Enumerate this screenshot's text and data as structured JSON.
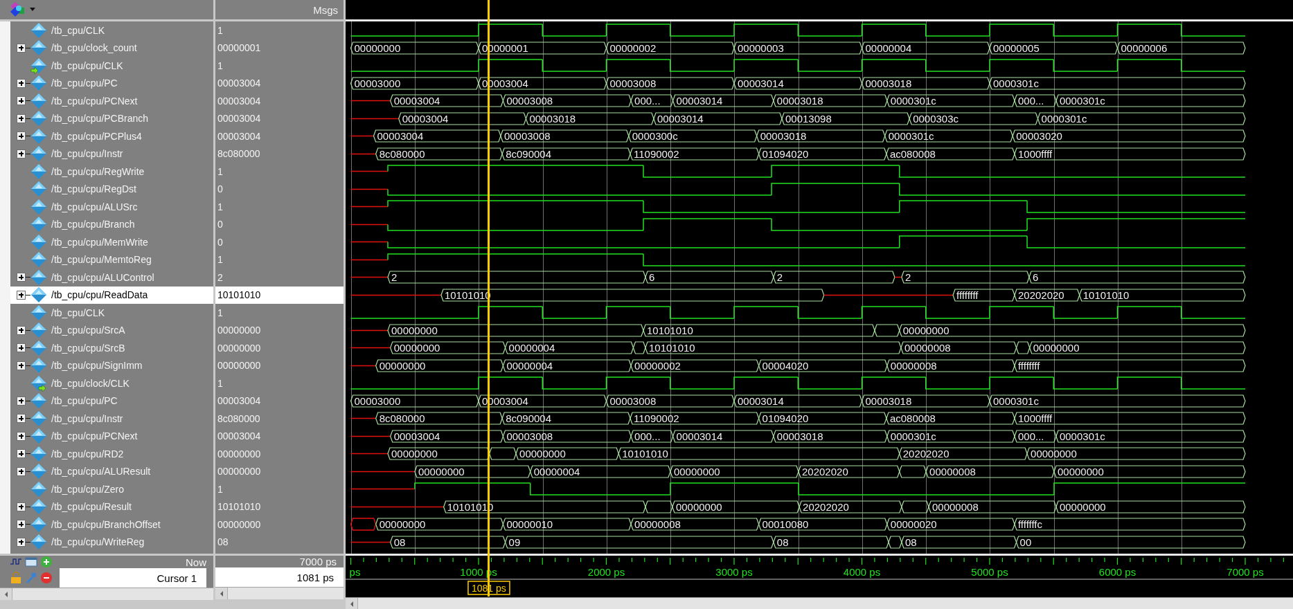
{
  "header": {
    "values_title": "Msgs"
  },
  "signals": [
    {
      "name": "/tb_cpu/CLK",
      "value": "1",
      "kind": "bit",
      "selected": false,
      "wave": [
        {
          "kind": "low"
        },
        {
          "kind": "high"
        },
        {
          "kind": "low"
        },
        {
          "kind": "high"
        },
        {
          "kind": "low"
        },
        {
          "kind": "high"
        },
        {
          "kind": "low"
        },
        {
          "kind": "high"
        },
        {
          "kind": "low"
        },
        {
          "kind": "high"
        },
        {
          "kind": "low"
        },
        {
          "kind": "high"
        },
        {
          "kind": "low"
        }
      ]
    },
    {
      "name": "/tb_cpu/clock_count",
      "value": "00000001",
      "kind": "bus",
      "expanded": false,
      "selected": false,
      "wave": [
        {
          "kind": "value",
          "text": "00000000"
        },
        {
          "kind": "value",
          "text": "00000001"
        },
        {
          "kind": "value",
          "text": "00000002"
        },
        {
          "kind": "value",
          "text": "00000003"
        },
        {
          "kind": "value",
          "text": "00000004"
        },
        {
          "kind": "value",
          "text": "00000005"
        },
        {
          "kind": "value",
          "text": "00000006"
        }
      ]
    },
    {
      "name": "/tb_cpu/cpu/CLK",
      "value": "1",
      "kind": "bit",
      "in_arrow": true,
      "selected": false,
      "wave": [
        {
          "kind": "low"
        },
        {
          "kind": "high"
        },
        {
          "kind": "low"
        },
        {
          "kind": "high"
        },
        {
          "kind": "low"
        },
        {
          "kind": "high"
        },
        {
          "kind": "low"
        },
        {
          "kind": "high"
        },
        {
          "kind": "low"
        },
        {
          "kind": "high"
        },
        {
          "kind": "low"
        },
        {
          "kind": "high"
        },
        {
          "kind": "low"
        }
      ]
    },
    {
      "name": "/tb_cpu/cpu/PC",
      "value": "00003004",
      "kind": "bus",
      "expanded": false,
      "selected": false,
      "wave": [
        {
          "kind": "value",
          "text": "00003000"
        },
        {
          "kind": "value",
          "text": "00003004"
        },
        {
          "kind": "value",
          "text": "00003008"
        },
        {
          "kind": "value",
          "text": "00003014"
        },
        {
          "kind": "value",
          "text": "00003018"
        },
        {
          "kind": "value",
          "text": "0000301c"
        }
      ]
    },
    {
      "name": "/tb_cpu/cpu/PCNext",
      "value": "00003004",
      "kind": "bus",
      "expanded": false,
      "selected": false,
      "wave": [
        {
          "kind": "unknown"
        },
        {
          "kind": "value",
          "text": "00003004"
        },
        {
          "kind": "value",
          "text": "00003008"
        },
        {
          "kind": "value",
          "text": "000..."
        },
        {
          "kind": "value",
          "text": "00003014"
        },
        {
          "kind": "value",
          "text": "00003018"
        },
        {
          "kind": "value",
          "text": "0000301c"
        },
        {
          "kind": "value",
          "text": "000..."
        },
        {
          "kind": "value",
          "text": "0000301c"
        }
      ]
    },
    {
      "name": "/tb_cpu/cpu/PCBranch",
      "value": "00003004",
      "kind": "bus",
      "expanded": false,
      "selected": false,
      "wave": [
        {
          "kind": "unknown"
        },
        {
          "kind": "value",
          "text": "00003004"
        },
        {
          "kind": "value",
          "text": "00003018"
        },
        {
          "kind": "value",
          "text": "00003014"
        },
        {
          "kind": "value",
          "text": "00013098"
        },
        {
          "kind": "value",
          "text": "0000303c"
        },
        {
          "kind": "value",
          "text": "0000301c"
        }
      ]
    },
    {
      "name": "/tb_cpu/cpu/PCPlus4",
      "value": "00003004",
      "kind": "bus",
      "expanded": false,
      "selected": false,
      "wave": [
        {
          "kind": "unknown"
        },
        {
          "kind": "value",
          "text": "00003004"
        },
        {
          "kind": "value",
          "text": "00003008"
        },
        {
          "kind": "value",
          "text": "0000300c"
        },
        {
          "kind": "value",
          "text": "00003018"
        },
        {
          "kind": "value",
          "text": "0000301c"
        },
        {
          "kind": "value",
          "text": "00003020"
        }
      ]
    },
    {
      "name": "/tb_cpu/cpu/Instr",
      "value": "8c080000",
      "kind": "bus",
      "expanded": false,
      "selected": false,
      "wave": [
        {
          "kind": "unknown"
        },
        {
          "kind": "value",
          "text": "8c080000"
        },
        {
          "kind": "value",
          "text": "8c090004"
        },
        {
          "kind": "value",
          "text": "11090002"
        },
        {
          "kind": "value",
          "text": "01094020"
        },
        {
          "kind": "value",
          "text": "ac080008"
        },
        {
          "kind": "value",
          "text": "1000ffff"
        }
      ]
    },
    {
      "name": "/tb_cpu/cpu/RegWrite",
      "value": "1",
      "kind": "bit",
      "selected": false,
      "wave": [
        {
          "kind": "unknown"
        },
        {
          "kind": "high"
        },
        {
          "kind": "low"
        },
        {
          "kind": "high"
        },
        {
          "kind": "low"
        }
      ]
    },
    {
      "name": "/tb_cpu/cpu/RegDst",
      "value": "0",
      "kind": "bit",
      "selected": false,
      "wave": [
        {
          "kind": "unknown"
        },
        {
          "kind": "low"
        },
        {
          "kind": "high"
        },
        {
          "kind": "low"
        }
      ]
    },
    {
      "name": "/tb_cpu/cpu/ALUSrc",
      "value": "1",
      "kind": "bit",
      "selected": false,
      "wave": [
        {
          "kind": "unknown"
        },
        {
          "kind": "high"
        },
        {
          "kind": "low"
        },
        {
          "kind": "high"
        },
        {
          "kind": "low"
        }
      ]
    },
    {
      "name": "/tb_cpu/cpu/Branch",
      "value": "0",
      "kind": "bit",
      "selected": false,
      "wave": [
        {
          "kind": "unknown"
        },
        {
          "kind": "low"
        },
        {
          "kind": "high"
        },
        {
          "kind": "low"
        },
        {
          "kind": "high"
        }
      ]
    },
    {
      "name": "/tb_cpu/cpu/MemWrite",
      "value": "0",
      "kind": "bit",
      "selected": false,
      "wave": [
        {
          "kind": "unknown"
        },
        {
          "kind": "low"
        },
        {
          "kind": "high"
        },
        {
          "kind": "low"
        }
      ]
    },
    {
      "name": "/tb_cpu/cpu/MemtoReg",
      "value": "1",
      "kind": "bit",
      "selected": false,
      "wave": [
        {
          "kind": "unknown"
        },
        {
          "kind": "high"
        },
        {
          "kind": "low"
        }
      ]
    },
    {
      "name": "/tb_cpu/cpu/ALUControl",
      "value": "2",
      "kind": "bus",
      "expanded": false,
      "selected": false,
      "wave": [
        {
          "kind": "unknown"
        },
        {
          "kind": "value",
          "text": "2"
        },
        {
          "kind": "value",
          "text": "6"
        },
        {
          "kind": "value",
          "text": "2"
        },
        {
          "kind": "unknown"
        },
        {
          "kind": "value",
          "text": "2"
        },
        {
          "kind": "value",
          "text": "6"
        }
      ]
    },
    {
      "name": "/tb_cpu/cpu/ReadData",
      "value": "10101010",
      "kind": "bus",
      "expanded": false,
      "selected": true,
      "wave": [
        {
          "kind": "unknown"
        },
        {
          "kind": "value",
          "text": "10101010"
        },
        {
          "kind": "unknown"
        },
        {
          "kind": "value",
          "text": "ffffffff"
        },
        {
          "kind": "value",
          "text": "20202020"
        },
        {
          "kind": "value",
          "text": "10101010"
        }
      ]
    },
    {
      "name": "/tb_cpu/CLK",
      "value": "1",
      "kind": "bit",
      "selected": false,
      "wave": [
        {
          "kind": "low"
        },
        {
          "kind": "high"
        },
        {
          "kind": "low"
        },
        {
          "kind": "high"
        },
        {
          "kind": "low"
        },
        {
          "kind": "high"
        },
        {
          "kind": "low"
        },
        {
          "kind": "high"
        },
        {
          "kind": "low"
        },
        {
          "kind": "high"
        },
        {
          "kind": "low"
        },
        {
          "kind": "high"
        },
        {
          "kind": "low"
        }
      ]
    },
    {
      "name": "/tb_cpu/cpu/SrcA",
      "value": "00000000",
      "kind": "bus",
      "expanded": false,
      "selected": false,
      "wave": [
        {
          "kind": "unknown"
        },
        {
          "kind": "value",
          "text": "00000000"
        },
        {
          "kind": "value",
          "text": "10101010"
        },
        {
          "kind": "blank"
        },
        {
          "kind": "value",
          "text": "00000000"
        }
      ]
    },
    {
      "name": "/tb_cpu/cpu/SrcB",
      "value": "00000000",
      "kind": "bus",
      "expanded": false,
      "selected": false,
      "wave": [
        {
          "kind": "unknown"
        },
        {
          "kind": "value",
          "text": "00000000"
        },
        {
          "kind": "value",
          "text": "00000004"
        },
        {
          "kind": "blank"
        },
        {
          "kind": "value",
          "text": "10101010"
        },
        {
          "kind": "value",
          "text": "00000008"
        },
        {
          "kind": "blank"
        },
        {
          "kind": "value",
          "text": "00000000"
        }
      ]
    },
    {
      "name": "/tb_cpu/cpu/SignImm",
      "value": "00000000",
      "kind": "bus",
      "expanded": false,
      "selected": false,
      "wave": [
        {
          "kind": "unknown"
        },
        {
          "kind": "value",
          "text": "00000000"
        },
        {
          "kind": "value",
          "text": "00000004"
        },
        {
          "kind": "value",
          "text": "00000002"
        },
        {
          "kind": "value",
          "text": "00004020"
        },
        {
          "kind": "value",
          "text": "00000008"
        },
        {
          "kind": "value",
          "text": "ffffffff"
        }
      ]
    },
    {
      "name": "/tb_cpu/clock/CLK",
      "value": "1",
      "kind": "bit",
      "out_arrow": true,
      "selected": false,
      "wave": [
        {
          "kind": "low"
        },
        {
          "kind": "high"
        },
        {
          "kind": "low"
        },
        {
          "kind": "high"
        },
        {
          "kind": "low"
        },
        {
          "kind": "high"
        },
        {
          "kind": "low"
        },
        {
          "kind": "high"
        },
        {
          "kind": "low"
        },
        {
          "kind": "high"
        },
        {
          "kind": "low"
        },
        {
          "kind": "high"
        },
        {
          "kind": "low"
        }
      ]
    },
    {
      "name": "/tb_cpu/cpu/PC",
      "value": "00003004",
      "kind": "bus",
      "expanded": false,
      "selected": false,
      "wave": [
        {
          "kind": "value",
          "text": "00003000"
        },
        {
          "kind": "value",
          "text": "00003004"
        },
        {
          "kind": "value",
          "text": "00003008"
        },
        {
          "kind": "value",
          "text": "00003014"
        },
        {
          "kind": "value",
          "text": "00003018"
        },
        {
          "kind": "value",
          "text": "0000301c"
        }
      ]
    },
    {
      "name": "/tb_cpu/cpu/Instr",
      "value": "8c080000",
      "kind": "bus",
      "expanded": false,
      "selected": false,
      "wave": [
        {
          "kind": "unknown"
        },
        {
          "kind": "value",
          "text": "8c080000"
        },
        {
          "kind": "value",
          "text": "8c090004"
        },
        {
          "kind": "value",
          "text": "11090002"
        },
        {
          "kind": "value",
          "text": "01094020"
        },
        {
          "kind": "value",
          "text": "ac080008"
        },
        {
          "kind": "value",
          "text": "1000ffff"
        }
      ]
    },
    {
      "name": "/tb_cpu/cpu/PCNext",
      "value": "00003004",
      "kind": "bus",
      "expanded": false,
      "selected": false,
      "wave": [
        {
          "kind": "unknown"
        },
        {
          "kind": "value",
          "text": "00003004"
        },
        {
          "kind": "value",
          "text": "00003008"
        },
        {
          "kind": "value",
          "text": "000..."
        },
        {
          "kind": "value",
          "text": "00003014"
        },
        {
          "kind": "value",
          "text": "00003018"
        },
        {
          "kind": "value",
          "text": "0000301c"
        },
        {
          "kind": "value",
          "text": "000..."
        },
        {
          "kind": "value",
          "text": "0000301c"
        }
      ]
    },
    {
      "name": "/tb_cpu/cpu/RD2",
      "value": "00000000",
      "kind": "bus",
      "expanded": false,
      "selected": false,
      "wave": [
        {
          "kind": "unknown"
        },
        {
          "kind": "value",
          "text": "00000000"
        },
        {
          "kind": "blank"
        },
        {
          "kind": "value",
          "text": "00000000"
        },
        {
          "kind": "value",
          "text": "10101010"
        },
        {
          "kind": "value",
          "text": "20202020"
        },
        {
          "kind": "value",
          "text": "00000000"
        }
      ]
    },
    {
      "name": "/tb_cpu/cpu/ALUResult",
      "value": "00000000",
      "kind": "bus",
      "expanded": false,
      "selected": false,
      "wave": [
        {
          "kind": "unknown"
        },
        {
          "kind": "value",
          "text": "00000000"
        },
        {
          "kind": "value",
          "text": "00000004"
        },
        {
          "kind": "value",
          "text": "00000000"
        },
        {
          "kind": "value",
          "text": "20202020"
        },
        {
          "kind": "blank"
        },
        {
          "kind": "value",
          "text": "00000008"
        },
        {
          "kind": "value",
          "text": "00000000"
        }
      ]
    },
    {
      "name": "/tb_cpu/cpu/Zero",
      "value": "1",
      "kind": "bit",
      "selected": false,
      "wave": [
        {
          "kind": "unknown"
        },
        {
          "kind": "high"
        },
        {
          "kind": "low"
        },
        {
          "kind": "high"
        },
        {
          "kind": "low"
        },
        {
          "kind": "high"
        }
      ]
    },
    {
      "name": "/tb_cpu/cpu/Result",
      "value": "10101010",
      "kind": "bus",
      "expanded": false,
      "selected": false,
      "wave": [
        {
          "kind": "unknown"
        },
        {
          "kind": "value",
          "text": "10101010"
        },
        {
          "kind": "blank"
        },
        {
          "kind": "value",
          "text": "00000000"
        },
        {
          "kind": "value",
          "text": "20202020"
        },
        {
          "kind": "blank"
        },
        {
          "kind": "value",
          "text": "00000008"
        },
        {
          "kind": "value",
          "text": "00000000"
        }
      ]
    },
    {
      "name": "/tb_cpu/cpu/BranchOffset",
      "value": "00000000",
      "kind": "bus",
      "expanded": false,
      "selected": false,
      "wave": [
        {
          "kind": "unknown-bus"
        },
        {
          "kind": "value",
          "text": "00000000"
        },
        {
          "kind": "value",
          "text": "00000010"
        },
        {
          "kind": "value",
          "text": "00000008"
        },
        {
          "kind": "value",
          "text": "00010080"
        },
        {
          "kind": "value",
          "text": "00000020"
        },
        {
          "kind": "value",
          "text": "fffffffc"
        }
      ]
    },
    {
      "name": "/tb_cpu/cpu/WriteReg",
      "value": "08",
      "kind": "bus",
      "expanded": false,
      "selected": false,
      "wave": [
        {
          "kind": "unknown"
        },
        {
          "kind": "value",
          "text": "08"
        },
        {
          "kind": "value",
          "text": "09"
        },
        {
          "kind": "value",
          "text": "08"
        },
        {
          "kind": "blank"
        },
        {
          "kind": "value",
          "text": "08"
        },
        {
          "kind": "value",
          "text": "00"
        }
      ]
    }
  ],
  "now": {
    "label": "Now",
    "value": "7000 ps"
  },
  "cursor": {
    "label": "Cursor 1",
    "value": "1081 ps",
    "flag": "1081 ps"
  },
  "timeline": {
    "ticks": [
      "ps",
      "1000 ps",
      "2000 ps",
      "3000 ps",
      "4000 ps",
      "5000 ps",
      "6000 ps",
      "7000 ps"
    ]
  }
}
